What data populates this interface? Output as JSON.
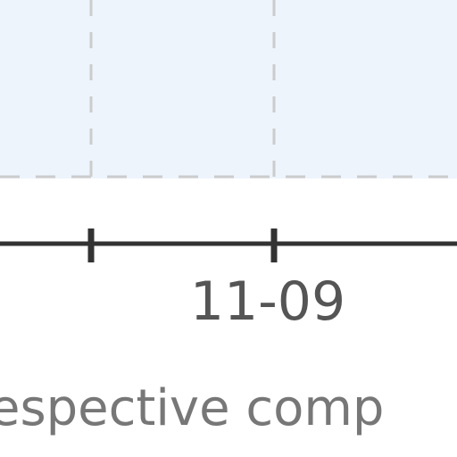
{
  "chart_data": {
    "type": "area",
    "x_tick_labels": [
      "",
      "11-09",
      ""
    ],
    "visible_tick_label": "11-09",
    "xlabel": "espective comp",
    "grid": true,
    "colors": {
      "plot_fill": "#edf4fc",
      "grid": "#cccccc",
      "axis": "#333333",
      "tick_text": "#555555",
      "label_text": "#777777"
    }
  }
}
